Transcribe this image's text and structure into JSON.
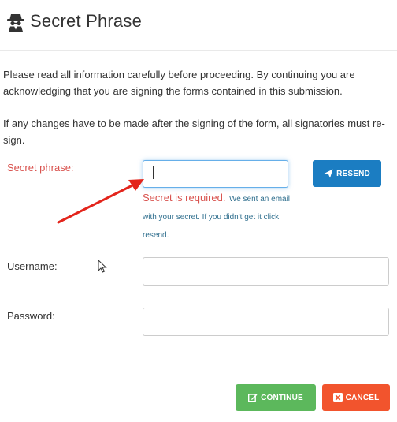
{
  "header": {
    "title": "Secret Phrase",
    "icon": "incognito-spy-icon"
  },
  "intro": {
    "paragraph1": "Please read all information carefully before proceeding. By continuing you are acknowledging that you are signing the forms contained in this submission.",
    "paragraph2": "If any changes have to be made after the signing of the form, all signatories must re-sign."
  },
  "form": {
    "secret_label": "Secret phrase:",
    "secret_value": "",
    "secret_required": "Secret is required.",
    "secret_note": "We sent an email with your secret. If you didn't get it click resend.",
    "resend_label": "RESEND",
    "username_label": "Username:",
    "username_value": "",
    "password_label": "Password:",
    "password_value": ""
  },
  "actions": {
    "continue_label": "CONTINUE",
    "cancel_label": "CANCEL"
  },
  "colors": {
    "error_red": "#d9534f",
    "info_blue": "#31708f",
    "resend_blue": "#1b7dc2",
    "continue_green": "#5cb85c",
    "cancel_orange": "#f2542d",
    "annotation_arrow": "#e3241b"
  }
}
